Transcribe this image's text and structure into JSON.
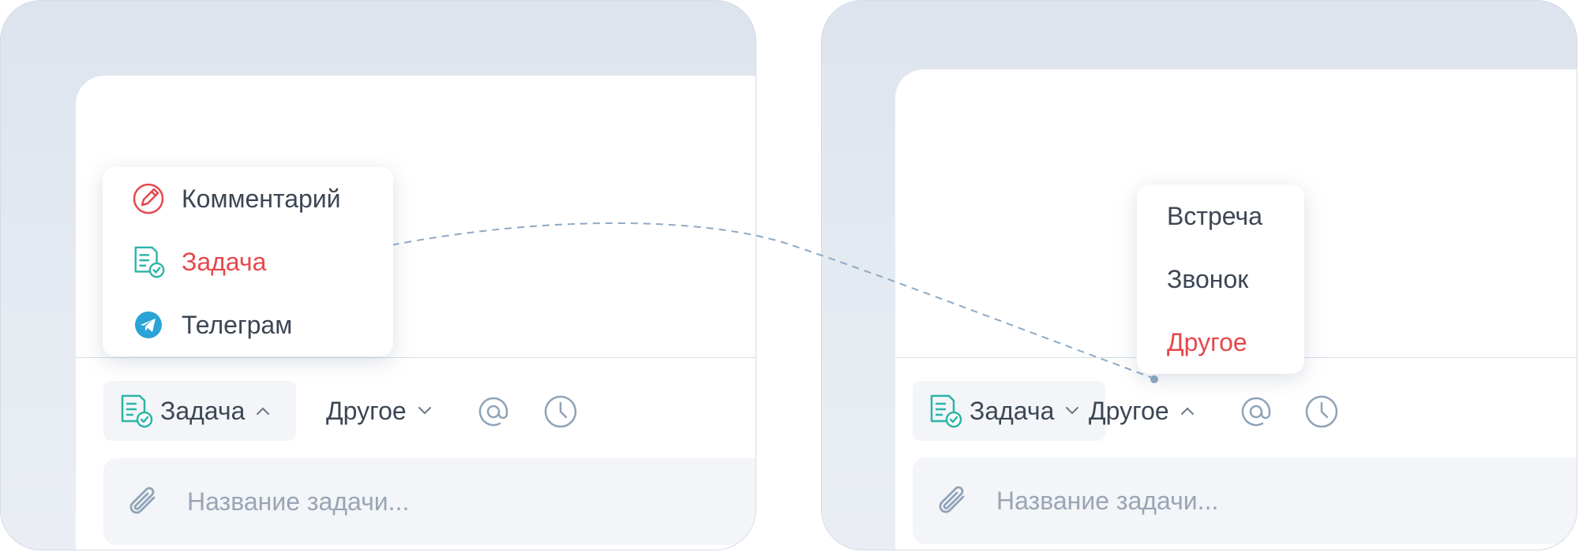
{
  "left_panel": {
    "menu": {
      "items": [
        {
          "label": "Комментарий",
          "icon": "comment-pen-icon",
          "active": false
        },
        {
          "label": "Задача",
          "icon": "task-doc-check-icon",
          "active": true
        },
        {
          "label": "Телеграм",
          "icon": "telegram-icon",
          "active": false
        }
      ]
    },
    "toolbar": {
      "type_label": "Задача",
      "type_caret": "up",
      "subtype_label": "Другое",
      "subtype_caret": "down"
    },
    "input": {
      "placeholder": "Название задачи..."
    }
  },
  "right_panel": {
    "menu": {
      "items": [
        {
          "label": "Встреча",
          "active": false
        },
        {
          "label": "Звонок",
          "active": false
        },
        {
          "label": "Другое",
          "active": true
        }
      ]
    },
    "toolbar": {
      "type_label": "Задача",
      "type_caret": "down",
      "subtype_label": "Другое",
      "subtype_caret": "up"
    },
    "input": {
      "placeholder": "Название задачи..."
    }
  },
  "colors": {
    "accent_red": "#e5484d",
    "teal_icon": "#2bb5a6",
    "icon_gray": "#8fa3b8",
    "telegram_blue": "#2aa3d6",
    "connector": "#8fa9c4"
  }
}
